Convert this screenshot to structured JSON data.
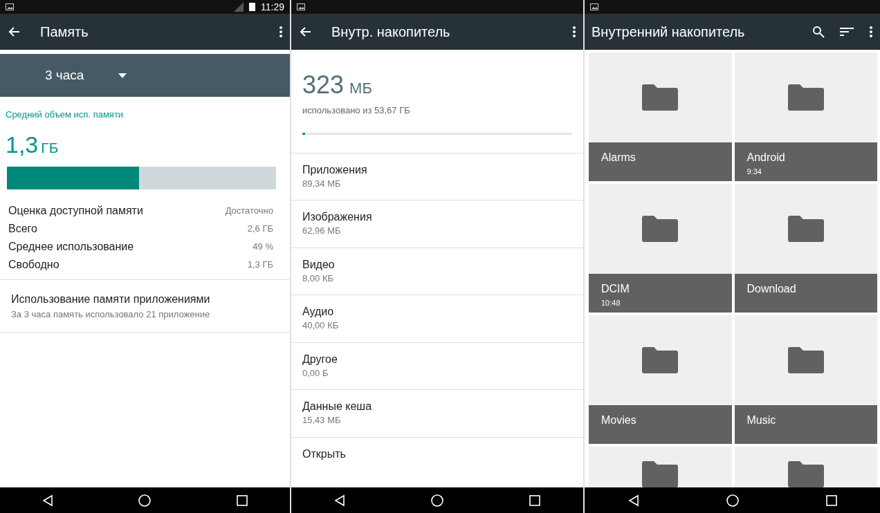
{
  "memory_screen": {
    "status_bar": {
      "time": "11:29"
    },
    "app_bar": {
      "title": "Память"
    },
    "period": {
      "value": "3 часа"
    },
    "average": {
      "label": "Средний объем исп. памяти",
      "value": "1,3",
      "unit": "ГБ",
      "level": 0.49
    },
    "stats": [
      {
        "label": "Оценка доступной памяти",
        "value": "Достаточно"
      },
      {
        "label": "Всего",
        "value": "2,6 ГБ"
      },
      {
        "label": "Среднее использование",
        "value": "49 %"
      },
      {
        "label": "Свободно",
        "value": "1,3 ГБ"
      }
    ],
    "app_usage": {
      "title": "Использование памяти приложениями",
      "summary": "За 3 часа память использовало 21 приложение"
    }
  },
  "storage_screen": {
    "app_bar": {
      "title": "Внутр. накопитель"
    },
    "used": {
      "value": "323",
      "unit": "МБ",
      "caption": "использовано из 53,67 ГБ",
      "level": 0.01
    },
    "items": [
      {
        "title": "Приложения",
        "size": "89,34 МБ"
      },
      {
        "title": "Изображения",
        "size": "62,96 МБ"
      },
      {
        "title": "Видео",
        "size": "8,00 КБ"
      },
      {
        "title": "Аудио",
        "size": "40,00 КБ"
      },
      {
        "title": "Другое",
        "size": "0,00 Б"
      },
      {
        "title": "Данные кеша",
        "size": "15,43 МБ"
      },
      {
        "title": "Открыть"
      }
    ]
  },
  "files_screen": {
    "app_bar": {
      "title": "Внутренний накопитель"
    },
    "folders": [
      {
        "kind": "folder",
        "name": "Alarms"
      },
      {
        "kind": "folder",
        "name": "Android",
        "time": "9:34"
      },
      {
        "kind": "folder",
        "name": "DCIM",
        "time": "10:48"
      },
      {
        "kind": "folder",
        "name": "Download"
      },
      {
        "kind": "folder",
        "name": "Movies"
      },
      {
        "kind": "folder",
        "name": "Music"
      },
      {
        "kind": "partial"
      },
      {
        "kind": "partial"
      }
    ]
  }
}
